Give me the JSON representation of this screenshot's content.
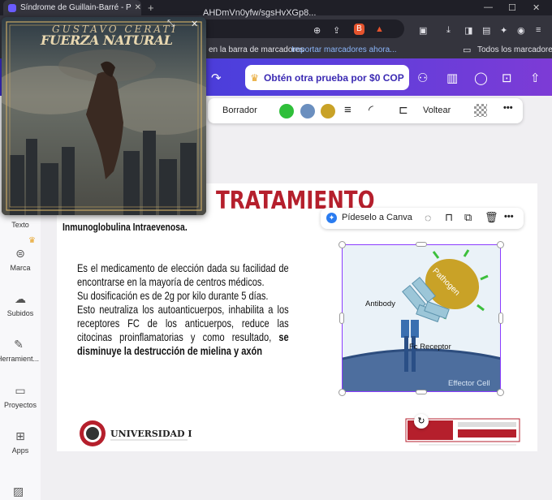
{
  "browser": {
    "tab_title": "Síndrome de Guillain-Barré - Pre",
    "url": "AHDmVn0yfw/sgsHvXGp8...",
    "bookmarks_hint": "en la barra de marcadores",
    "import_bookmarks": "Importar marcadores ahora...",
    "all_bookmarks": "Todos los marcadores"
  },
  "canva": {
    "trial_button": "Obtén otra prueba por $0 COP",
    "toolbar": {
      "eraser": "Borrador",
      "flip": "Voltear",
      "swatches": [
        "#2fbf3a",
        "#6b8fbf",
        "#c9a227"
      ]
    },
    "ask_canva": "Pídeselo a Canva",
    "sidebar": [
      {
        "label": "Texto",
        "icon": "text-icon"
      },
      {
        "label": "Marca",
        "icon": "brand-icon"
      },
      {
        "label": "Subidos",
        "icon": "upload-icon"
      },
      {
        "label": "Herramient...",
        "icon": "tools-icon"
      },
      {
        "label": "Proyectos",
        "icon": "folder-icon"
      },
      {
        "label": "Apps",
        "icon": "apps-icon"
      }
    ]
  },
  "slide": {
    "title": "TRATAMIENTO",
    "subtitle": "Inmunoglobulina Intraevenosa.",
    "paragraph1": "Es el medicamento de elección dada su facilidad de encontrarse en la mayoría de centros médicos.",
    "paragraph2": "Su dosificación es de 2g por kilo durante 5 días.",
    "paragraph3": "Esto neutraliza los autoanticuerpos, inhabilita a los receptores FC de los anticuerpos, reduce las citocinas proinflamatorias y como resultado,",
    "paragraph3_bold": "se disminuye la destrucción de mielina y axón",
    "diagram": {
      "pathogen": "Pathogen",
      "antibody": "Antibody",
      "receptor": "Fc Receptor",
      "cell": "Effector Cell"
    },
    "logo_left": "UNIVERSIDAD LIBRE"
  },
  "pip": {
    "artist": "GUSTAVO CERATI",
    "album": "FUERZA NATURAL"
  }
}
